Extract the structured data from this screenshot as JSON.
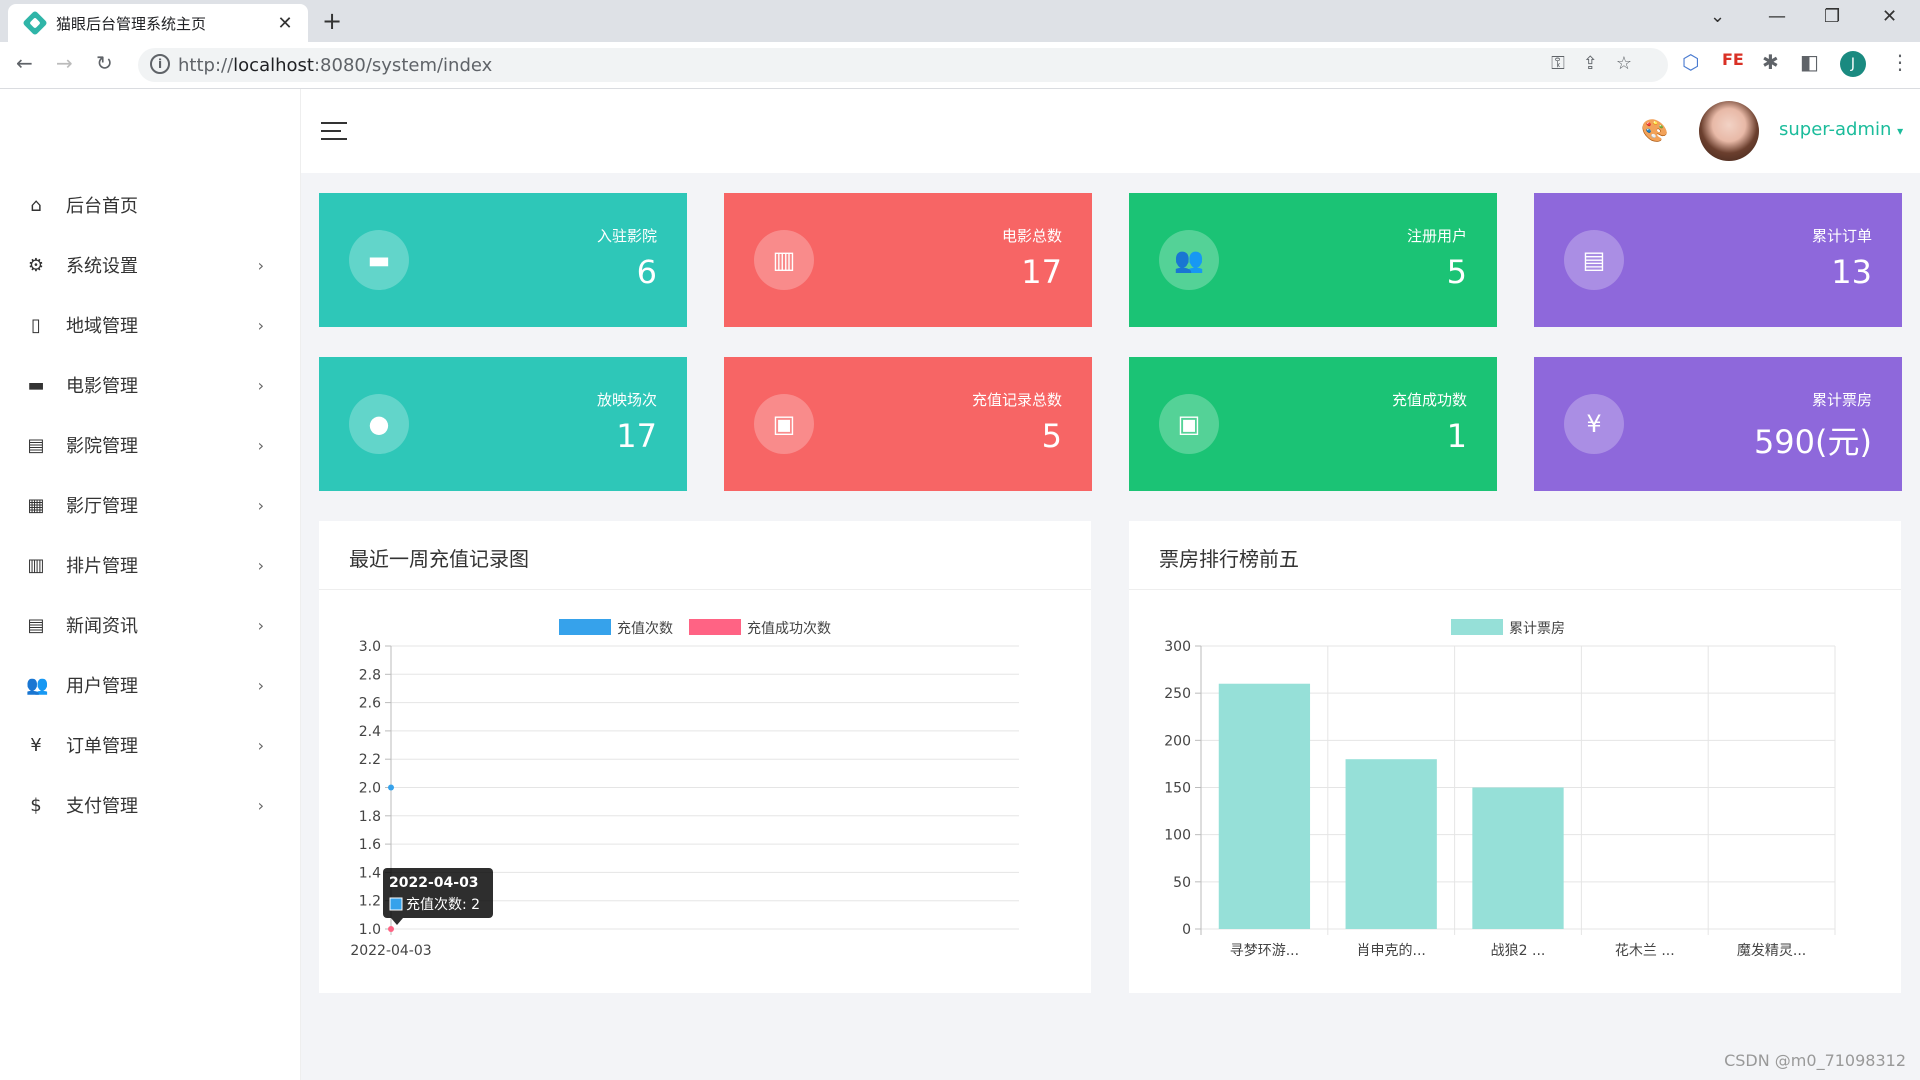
{
  "browser": {
    "tab_title": "猫眼后台管理系统主页",
    "url_scheme": "http://",
    "url_host": "localhost",
    "url_path": ":8080/system/index",
    "profile_initial": "J"
  },
  "header": {
    "username": "super-admin"
  },
  "sidebar": {
    "items": [
      {
        "label": "后台首页",
        "icon": "home-icon",
        "glyph": "⌂",
        "has_arrow": false
      },
      {
        "label": "系统设置",
        "icon": "gear-icon",
        "glyph": "⚙",
        "has_arrow": true
      },
      {
        "label": "地域管理",
        "icon": "map-icon",
        "glyph": "▯",
        "has_arrow": true
      },
      {
        "label": "电影管理",
        "icon": "clapperboard-icon",
        "glyph": "▬",
        "has_arrow": true
      },
      {
        "label": "影院管理",
        "icon": "store-icon",
        "glyph": "▤",
        "has_arrow": true
      },
      {
        "label": "影厅管理",
        "icon": "building-icon",
        "glyph": "▦",
        "has_arrow": true
      },
      {
        "label": "排片管理",
        "icon": "film-icon",
        "glyph": "▥",
        "has_arrow": true
      },
      {
        "label": "新闻资讯",
        "icon": "news-icon",
        "glyph": "▤",
        "has_arrow": true
      },
      {
        "label": "用户管理",
        "icon": "users-icon",
        "glyph": "👥",
        "has_arrow": true
      },
      {
        "label": "订单管理",
        "icon": "yen-icon",
        "glyph": "¥",
        "has_arrow": true
      },
      {
        "label": "支付管理",
        "icon": "dollar-icon",
        "glyph": "$",
        "has_arrow": true
      }
    ],
    "arrow": "›"
  },
  "stats": [
    {
      "label": "入驻影院",
      "value": "6",
      "color": "#2ec7b8",
      "icon": "clapperboard-icon",
      "glyph": "▬"
    },
    {
      "label": "电影总数",
      "value": "17",
      "color": "#f76565",
      "icon": "film-icon",
      "glyph": "▥"
    },
    {
      "label": "注册用户",
      "value": "5",
      "color": "#1bc375",
      "icon": "users-icon",
      "glyph": "👥"
    },
    {
      "label": "累计订单",
      "value": "13",
      "color": "#8e68db",
      "icon": "receipt-icon",
      "glyph": "▤"
    },
    {
      "label": "放映场次",
      "value": "17",
      "color": "#2ec7b8",
      "icon": "lightbulb-icon",
      "glyph": "●"
    },
    {
      "label": "充值记录总数",
      "value": "5",
      "color": "#f76565",
      "icon": "money-stack-icon",
      "glyph": "▣"
    },
    {
      "label": "充值成功数",
      "value": "1",
      "color": "#1bc375",
      "icon": "money-icon",
      "glyph": "▣"
    },
    {
      "label": "累计票房",
      "value": "590(元)",
      "color": "#8e68db",
      "icon": "yen-icon",
      "glyph": "¥"
    }
  ],
  "panels": {
    "recharge_title": "最近一周充值记录图",
    "boxoffice_title": "票房排行榜前五"
  },
  "chart_data": [
    {
      "type": "line",
      "title": "最近一周充值记录图",
      "x": [
        "2022-04-03"
      ],
      "series": [
        {
          "name": "充值次数",
          "values": [
            2
          ],
          "color": "#36a2eb"
        },
        {
          "name": "充值成功次数",
          "values": [
            1
          ],
          "color": "#ff6384"
        }
      ],
      "ylim": [
        1.0,
        3.0
      ],
      "yticks": [
        "3.0",
        "2.8",
        "2.6",
        "2.4",
        "2.2",
        "2.0",
        "1.8",
        "1.6",
        "1.4",
        "1.2",
        "1.0"
      ],
      "grid": true,
      "legend": "top-center",
      "tooltip": {
        "title": "2022-04-03",
        "line": "充值次数: 2"
      }
    },
    {
      "type": "bar",
      "title": "票房排行榜前五",
      "categories": [
        "寻梦环游...",
        "肖申克的...",
        "战狼2 ...",
        "花木兰 ...",
        "魔发精灵..."
      ],
      "series": [
        {
          "name": "累计票房",
          "values": [
            260,
            180,
            150,
            0,
            0
          ],
          "color": "#96e0d8"
        }
      ],
      "ylim": [
        0,
        300
      ],
      "yticks": [
        "300",
        "250",
        "200",
        "150",
        "100",
        "50",
        "0"
      ],
      "grid": true,
      "legend": "top-center"
    }
  ],
  "watermark": "CSDN @m0_71098312"
}
